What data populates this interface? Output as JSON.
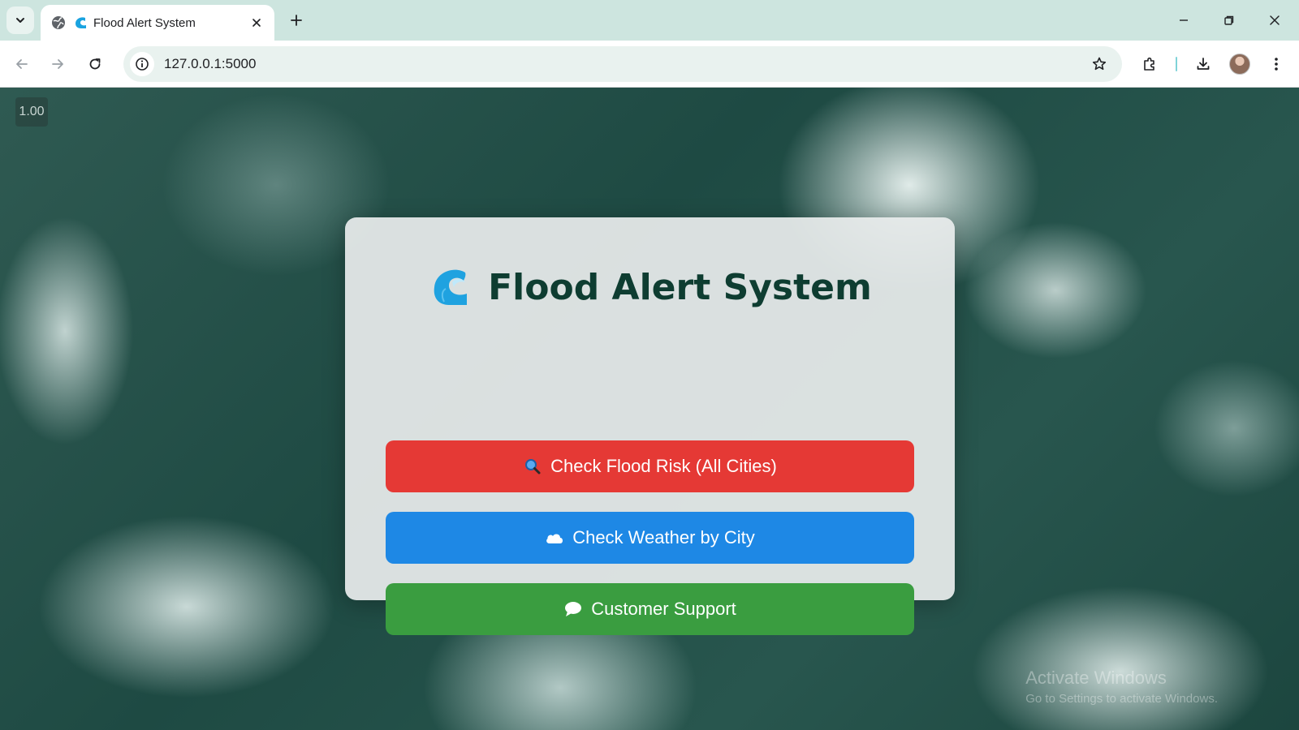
{
  "browser": {
    "tab_title": "Flood Alert System",
    "url": "127.0.0.1:5000"
  },
  "page": {
    "zoom_badge": "1.00",
    "title": "Flood Alert System",
    "buttons": [
      {
        "label": "Check Flood Risk (All Cities)",
        "icon": "magnifier-icon",
        "color": "#e53935"
      },
      {
        "label": "Check Weather by City",
        "icon": "cloud-icon",
        "color": "#1e88e5"
      },
      {
        "label": "Customer Support",
        "icon": "speech-bubble-icon",
        "color": "#3a9d40"
      }
    ],
    "watermark": {
      "line1": "Activate Windows",
      "line2": "Go to Settings to activate Windows."
    }
  },
  "colors": {
    "title": "#0e3d31",
    "tabbar": "#cde5df"
  }
}
